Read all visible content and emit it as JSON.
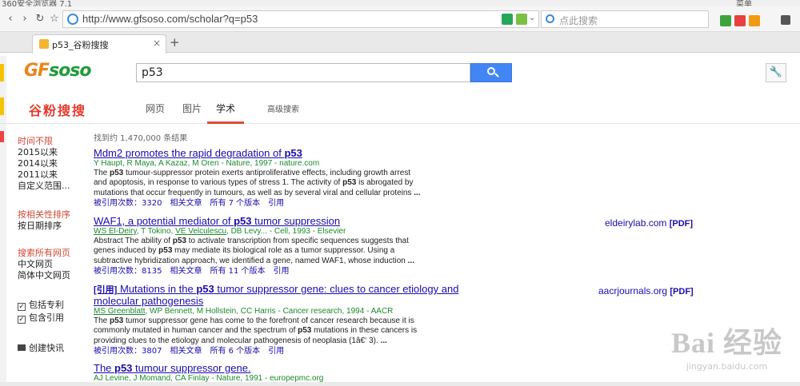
{
  "browser": {
    "title": "360安全浏览器 7.1",
    "url": "http://www.gfsoso.com/scholar?q=p53",
    "search_placeholder": "点此搜索",
    "tab_title": "p53_谷粉搜搜",
    "menu_label": "菜单"
  },
  "site": {
    "logo_main": "GF",
    "logo_sub": "soso",
    "brand_cn": "谷粉搜搜",
    "query": "p53",
    "nav_tabs": [
      {
        "label": "网页",
        "active": false
      },
      {
        "label": "图片",
        "active": false
      },
      {
        "label": "学术",
        "active": true
      },
      {
        "label": "高级搜索",
        "active": false
      }
    ]
  },
  "sidebar": {
    "time_filters": [
      "时间不限",
      "2015以来",
      "2014以来",
      "2011以来",
      "自定义范围..."
    ],
    "sort": [
      "按相关性排序",
      "按日期排序"
    ],
    "languages": [
      "搜索所有网页",
      "中文网页",
      "简体中文网页"
    ],
    "checkboxes": [
      {
        "label": "包括专利",
        "checked": true
      },
      {
        "label": "包含引用",
        "checked": true
      }
    ],
    "alert": "创建快讯"
  },
  "results_count": "找到约 1,470,000 条结果",
  "results": [
    {
      "prefix": "",
      "title_parts": [
        "Mdm2 promotes the rapid degradation of ",
        "p53",
        ""
      ],
      "authors": "Y Haupt, R Maya, A Kazaz, M Oren - Nature, 1997 - nature.com",
      "desc_lines": [
        [
          "The ",
          "p53",
          " tumour-suppressor protein exerts antiproliferative effects, including growth arrest"
        ],
        [
          "and apoptosis, in response to various types of stress 1. The activity of ",
          "p53",
          " is abrogated by"
        ],
        [
          "mutations that occur frequently in tumours, as well as by several viral and cellular proteins ",
          "...",
          ""
        ]
      ],
      "links": [
        "被引用次数：3320",
        "相关文章",
        "所有 7 个版本",
        "引用"
      ],
      "side": "",
      "side_tag": ""
    },
    {
      "prefix": "",
      "title_parts": [
        "WAF1, a potential mediator of ",
        "p53",
        " tumor suppression"
      ],
      "authors": "WS El-Deiry, T Tokino, VE Velculescu, DB Levy... - Cell, 1993 - Elsevier",
      "desc_lines": [
        [
          "Abstract The ability of ",
          "p53",
          " to activate transcription from specific sequences suggests that"
        ],
        [
          "genes induced by ",
          "p53",
          " may mediate its biological role as a tumor suppressor. Using a"
        ],
        [
          "subtractive hybridization approach, we identified a gene, named WAF1, whose induction ",
          "...",
          ""
        ]
      ],
      "links": [
        "被引用次数：8135",
        "相关文章",
        "所有 11 个版本",
        "引用"
      ],
      "side": "eldeirylab.com",
      "side_tag": "[PDF]"
    },
    {
      "prefix": "[引用]",
      "title_parts": [
        "Mutations in the ",
        "p53",
        " tumor suppressor gene: clues to cancer etiology and molecular pathogenesis"
      ],
      "authors": "MS Greenblatt, WP Bennett, M Hollstein, CC Harris - Cancer research, 1994 - AACR",
      "desc_lines": [
        [
          "The ",
          "p53",
          " tumor suppressor gene has come to the forefront of cancer research because it is"
        ],
        [
          "commonly mutated in human cancer and the spectrum of ",
          "p53",
          " mutations in these cancers is"
        ],
        [
          "providing clues to the etiology and molecular pathogenesis of neoplasia (1â€‘ 3). ",
          "...",
          ""
        ]
      ],
      "links": [
        "被引用次数：3807",
        "相关文章",
        "所有 6 个版本",
        "引用"
      ],
      "side": "aacrjournals.org",
      "side_tag": "[PDF]"
    },
    {
      "prefix": "",
      "title_parts": [
        "The ",
        "p53",
        " tumour suppressor gene."
      ],
      "authors": "AJ Levine, J Momand, CA Finlay - Nature, 1991 - europepmc.org",
      "desc_lines": [],
      "links": [],
      "side": "",
      "side_tag": ""
    }
  ],
  "watermark": {
    "line1": "Bai 经验",
    "line2": "jingyan.baidu.com"
  }
}
